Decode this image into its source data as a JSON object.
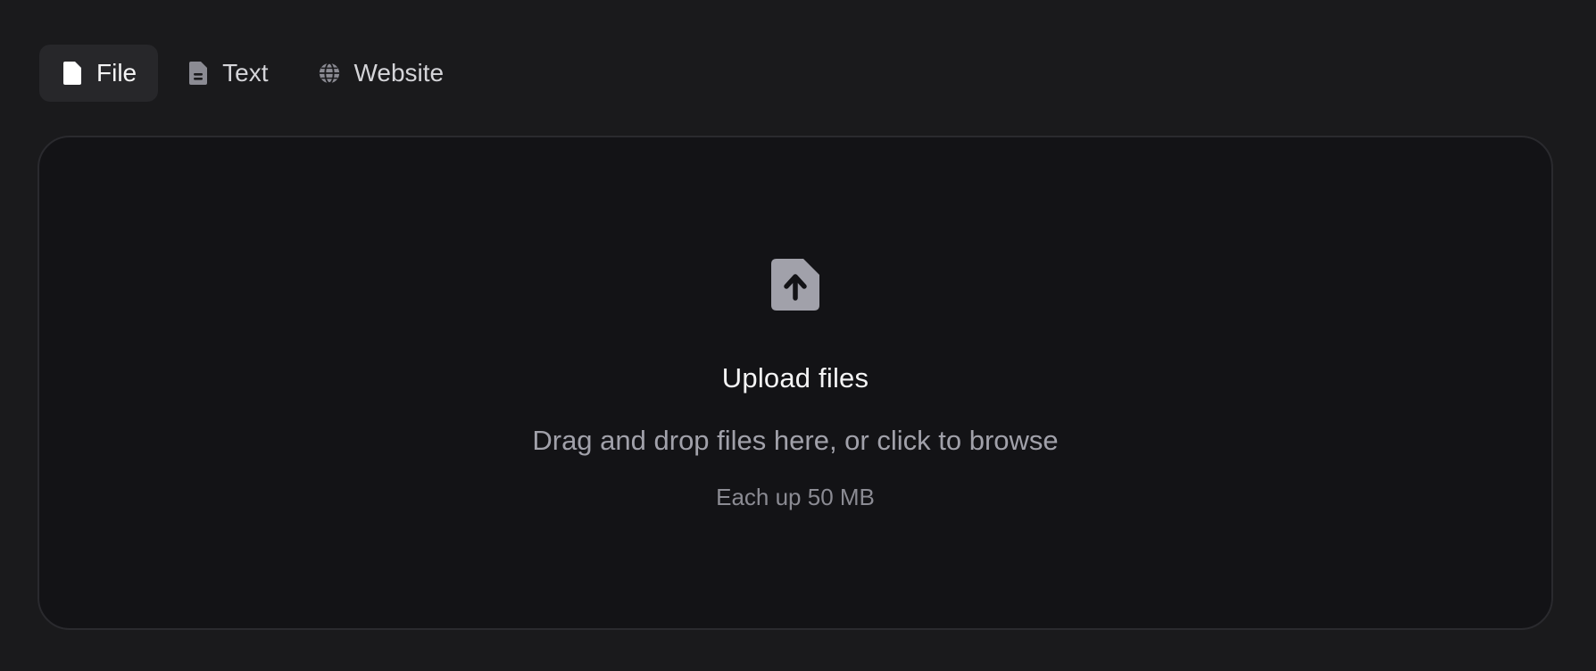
{
  "tabs": [
    {
      "label": "File",
      "icon": "file-icon",
      "active": true
    },
    {
      "label": "Text",
      "icon": "text-document-icon",
      "active": false
    },
    {
      "label": "Website",
      "icon": "globe-icon",
      "active": false
    }
  ],
  "dropzone": {
    "icon": "file-upload-icon",
    "title": "Upload files",
    "subtitle": "Drag and drop files here, or click to browse",
    "hint": "Each up 50 MB"
  },
  "colors": {
    "background": "#1a1a1c",
    "active_tab_bg": "#27272a",
    "dropzone_bg": "#131316",
    "dropzone_border": "#2a2a2e",
    "icon_gray": "#a1a1aa"
  }
}
